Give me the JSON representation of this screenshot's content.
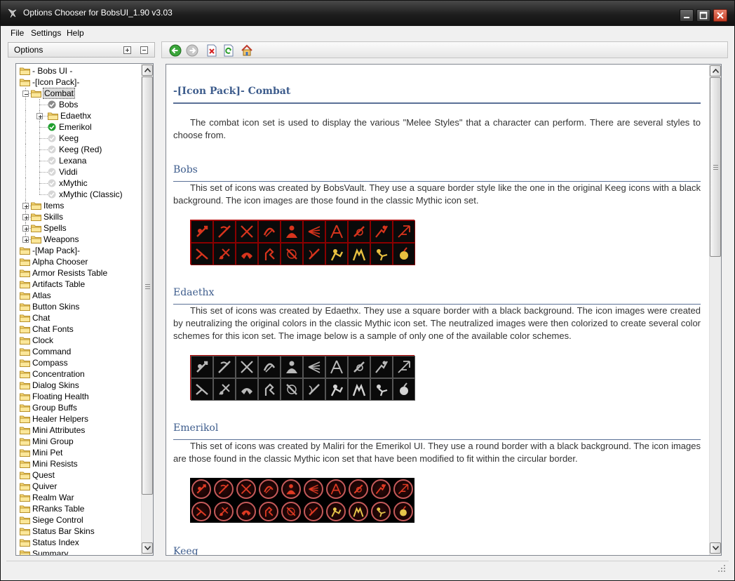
{
  "window": {
    "title": "Options Chooser for BobsUI_1.90 v3.03"
  },
  "menu": [
    "File",
    "Settings",
    "Help"
  ],
  "left_panel": {
    "header": "Options"
  },
  "tree": [
    {
      "label": "- Bobs UI -",
      "level": 0,
      "type": "folder"
    },
    {
      "label": "-[Icon Pack]-",
      "level": 0,
      "type": "folder"
    },
    {
      "label": "Combat",
      "level": 1,
      "type": "folder",
      "expander": "minus",
      "selected": true
    },
    {
      "label": "Bobs",
      "level": 2,
      "type": "check",
      "state": "gray"
    },
    {
      "label": "Edaethx",
      "level": 2,
      "type": "folder",
      "expander": "plus"
    },
    {
      "label": "Emerikol",
      "level": 2,
      "type": "check",
      "state": "green"
    },
    {
      "label": "Keeg",
      "level": 2,
      "type": "check",
      "state": "light"
    },
    {
      "label": "Keeg (Red)",
      "level": 2,
      "type": "check",
      "state": "light"
    },
    {
      "label": "Lexana",
      "level": 2,
      "type": "check",
      "state": "light"
    },
    {
      "label": "Viddi",
      "level": 2,
      "type": "check",
      "state": "light"
    },
    {
      "label": "xMythic",
      "level": 2,
      "type": "check",
      "state": "light"
    },
    {
      "label": "xMythic (Classic)",
      "level": 2,
      "type": "check",
      "state": "light"
    },
    {
      "label": "Items",
      "level": 1,
      "type": "folder",
      "expander": "plus"
    },
    {
      "label": "Skills",
      "level": 1,
      "type": "folder",
      "expander": "plus"
    },
    {
      "label": "Spells",
      "level": 1,
      "type": "folder",
      "expander": "plus"
    },
    {
      "label": "Weapons",
      "level": 1,
      "type": "folder",
      "expander": "plus"
    },
    {
      "label": "-[Map Pack]-",
      "level": 0,
      "type": "folder"
    },
    {
      "label": "Alpha Chooser",
      "level": 0,
      "type": "folder"
    },
    {
      "label": "Armor Resists Table",
      "level": 0,
      "type": "folder"
    },
    {
      "label": "Artifacts Table",
      "level": 0,
      "type": "folder"
    },
    {
      "label": "Atlas",
      "level": 0,
      "type": "folder"
    },
    {
      "label": "Button Skins",
      "level": 0,
      "type": "folder"
    },
    {
      "label": "Chat",
      "level": 0,
      "type": "folder"
    },
    {
      "label": "Chat Fonts",
      "level": 0,
      "type": "folder"
    },
    {
      "label": "Clock",
      "level": 0,
      "type": "folder"
    },
    {
      "label": "Command",
      "level": 0,
      "type": "folder"
    },
    {
      "label": "Compass",
      "level": 0,
      "type": "folder"
    },
    {
      "label": "Concentration",
      "level": 0,
      "type": "folder"
    },
    {
      "label": "Dialog Skins",
      "level": 0,
      "type": "folder"
    },
    {
      "label": "Floating Health",
      "level": 0,
      "type": "folder"
    },
    {
      "label": "Group Buffs",
      "level": 0,
      "type": "folder"
    },
    {
      "label": "Healer Helpers",
      "level": 0,
      "type": "folder"
    },
    {
      "label": "Mini Attributes",
      "level": 0,
      "type": "folder"
    },
    {
      "label": "Mini Group",
      "level": 0,
      "type": "folder"
    },
    {
      "label": "Mini Pet",
      "level": 0,
      "type": "folder"
    },
    {
      "label": "Mini Resists",
      "level": 0,
      "type": "folder"
    },
    {
      "label": "Quest",
      "level": 0,
      "type": "folder"
    },
    {
      "label": "Quiver",
      "level": 0,
      "type": "folder"
    },
    {
      "label": "Realm War",
      "level": 0,
      "type": "folder"
    },
    {
      "label": "RRanks Table",
      "level": 0,
      "type": "folder"
    },
    {
      "label": "Siege Control",
      "level": 0,
      "type": "folder"
    },
    {
      "label": "Status Bar Skins",
      "level": 0,
      "type": "folder"
    },
    {
      "label": "Status Index",
      "level": 0,
      "type": "folder"
    },
    {
      "label": "Summary",
      "level": 0,
      "type": "folder"
    }
  ],
  "toolbar": [
    {
      "name": "back-button",
      "icon": "arrow-left-green-icon",
      "enabled": true
    },
    {
      "name": "forward-button",
      "icon": "arrow-right-gray-icon",
      "enabled": false
    },
    {
      "name": "stop-button",
      "icon": "stop-page-icon",
      "enabled": true
    },
    {
      "name": "refresh-button",
      "icon": "refresh-icon",
      "enabled": true
    },
    {
      "name": "home-button",
      "icon": "home-icon",
      "enabled": true
    }
  ],
  "content": {
    "title": "-[Icon Pack]- Combat",
    "intro": "The combat icon set is used to display the various \"Melee Styles\" that a character can perform. There are several styles to choose from.",
    "sections": [
      {
        "heading": "Bobs",
        "text": "This set of icons was created by BobsVault. They use a square border style like the one in the original Keeg icons with a black background. The icon images are those found in the classic Mythic icon set.",
        "style": "red-square"
      },
      {
        "heading": "Edaethx",
        "text": "This set of icons was created by Edaethx. They use a square border with a black background. The icon images were created by neutralizing the original colors in the classic Mythic icon set. The neutralized images were then colorized to create several color schemes for this icon set. The image below is a sample of only one of the available color schemes.",
        "style": "gray-square"
      },
      {
        "heading": "Emerikol",
        "text": "This set of icons was created by Maliri for the Emerikol UI. They use a round border with a black background. The icon images are those found in the classic Mythic icon set that have been modified to fit within the circular border.",
        "style": "red-round"
      },
      {
        "heading": "Keeg",
        "text": "",
        "style": "none"
      }
    ]
  },
  "colors": {
    "heading": "#3d5c8c",
    "rule": "#5a7096",
    "icon_border_red": "#b00000",
    "check_green": "#1e9e2e"
  }
}
